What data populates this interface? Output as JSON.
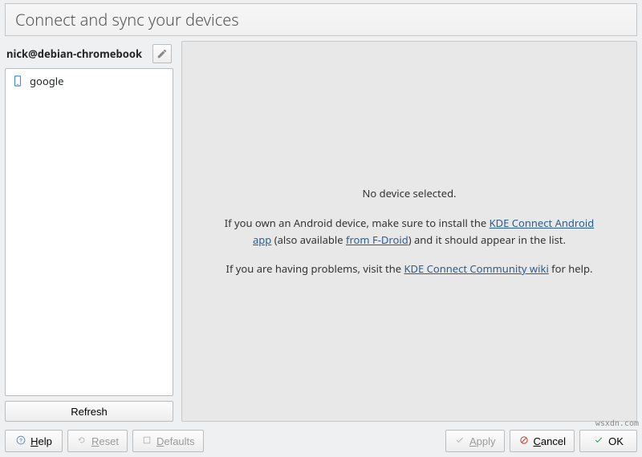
{
  "title": "Connect and sync your devices",
  "hostname": "nick@debian-chromebook",
  "devices": [
    {
      "name": "google"
    }
  ],
  "refresh_label": "Refresh",
  "detail": {
    "no_device": "No device selected.",
    "line1_a": "If you own an Android device, make sure to install the ",
    "link1": "KDE Connect Android app",
    "line1_b": " (also available ",
    "link2": "from F-Droid",
    "line1_c": ") and it should appear in the list.",
    "line2_a": "If you are having problems, visit the ",
    "link3": "KDE Connect Community wiki",
    "line2_b": " for help."
  },
  "buttons": {
    "help": "Help",
    "reset": "Reset",
    "defaults": "Defaults",
    "apply": "Apply",
    "cancel": "Cancel",
    "ok": "OK"
  },
  "watermark": "wsxdn.com"
}
